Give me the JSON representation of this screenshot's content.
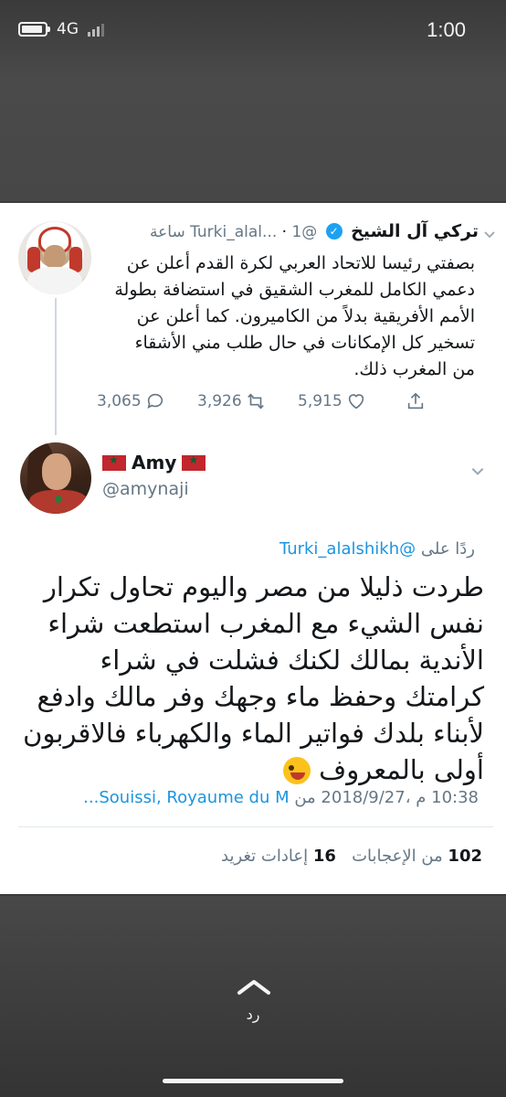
{
  "status_bar": {
    "network": "4G",
    "time": "1:00"
  },
  "parent_tweet": {
    "name": "تركي آل الشيخ",
    "handle": "@Turki_alal...",
    "time": "1 ساعة",
    "text": "بصفتي رئيسا للاتحاد العربي لكرة القدم أعلن عن دعمي الكامل للمغرب الشقيق في استضافة بطولة الأمم الأفريقية بدلاً من الكاميرون. كما أعلن عن تسخير كل الإمكانات في حال طلب مني الأشقاء من المغرب ذلك.",
    "replies": "3,065",
    "retweets": "3,926",
    "likes": "5,915"
  },
  "reply_tweet": {
    "name": "Amy",
    "handle": "@amynaji",
    "replying_to_label": "ردًا على",
    "replying_to_mention": "@Turki_alalshikh",
    "text": "طردت ذليلا من مصر واليوم تحاول تكرار نفس الشيء مع المغرب استطعت شراء الأندية بمالك لكنك فشلت في شراء كرامتك وحفظ ماء وجهك وفر مالك وادفع لأبناء بلدك فواتير الماء والكهرباء فالاقربون أولى بالمعروف",
    "timestamp": "10:38 م ،2018/9/27",
    "location_prefix": "من",
    "location": "Souissi, Royaume du M...",
    "likes_count": "102",
    "likes_label": "من الإعجابات",
    "retweets_count": "16",
    "retweets_label": "إعادات تغريد"
  },
  "bottom": {
    "reply_label": "رد"
  },
  "colors": {
    "accent": "#1da1f2",
    "link": "#1b95e0",
    "muted": "#657786",
    "text": "#14171a",
    "flag_red": "#c1272d"
  }
}
